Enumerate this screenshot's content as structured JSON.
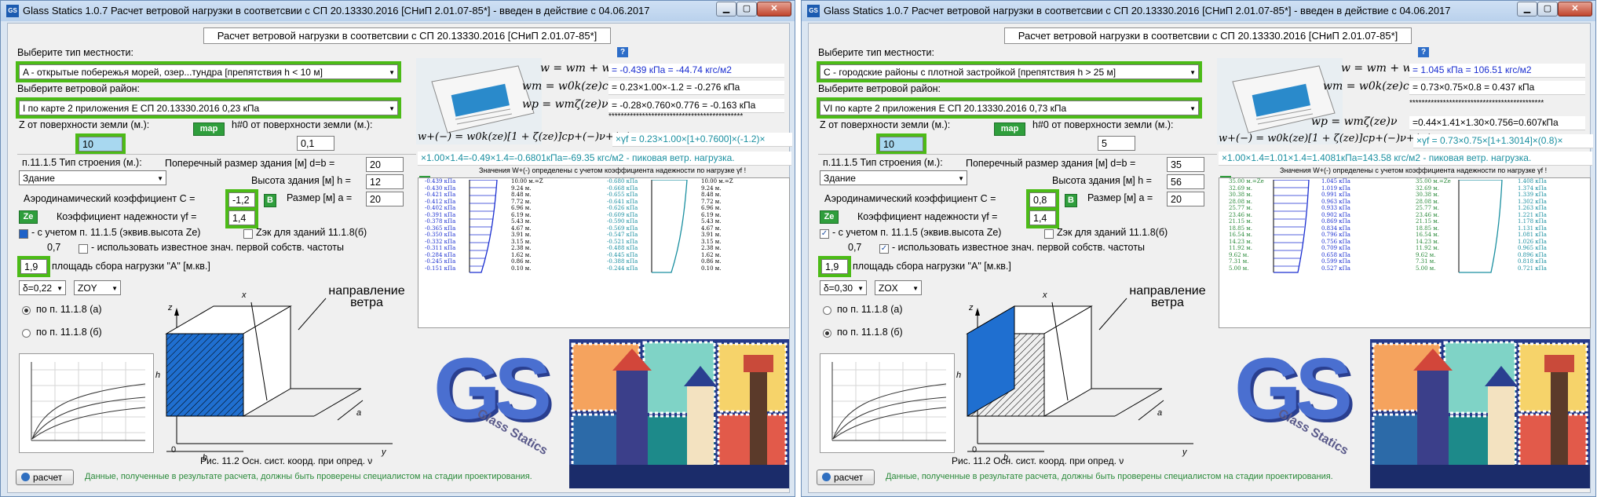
{
  "window_title": "Glass Statics 1.0.7 Расчет ветровой нагрузки в соответсвии с СП 20.13330.2016 [СНиП 2.01.07-85*] - введен в действие с 04.06.2017",
  "header": "Расчет ветровой нагрузки в соответсвии с СП 20.13330.2016 [СНиП 2.01.07-85*]",
  "labels": {
    "terrain": "Выберите тип местности:",
    "region": "Выберите ветровой район:",
    "z_label": "Z от поверхности земли (м.):",
    "h0_label": "h#0 от поверхности земли (м.):",
    "map_btn": "map",
    "type_label": "п.11.1.5 Тип строения (м.):",
    "d_label": "Поперечный размер здания [м] d=b =",
    "h_label": "Высота здания [м] h =",
    "a_label": "Размер [м] a =",
    "aero_label": "Аэродинамический коэффициент С =",
    "safety_label": "Коэффициент надежности γf =",
    "ze_btn": "Ze",
    "b_btn": "B",
    "chk_ze": "- с учетом п. 11.1.5 (эквив.высота Ze)",
    "chk_zek": "Zэк для зданий 11.1.8(б)",
    "chk_freq": "- использовать известное знач. первой собств. частоты",
    "area_label": "площадь сбора нагрузки \"А\" [м.кв.]",
    "radio_a": "по п. 11.1.8 (а)",
    "radio_b": "по п. 11.1.8 (б)",
    "wind_dir": "направление ветра",
    "fig_caption": "Рис. 11.2 Осн. сист. коорд. при опред. ν",
    "note_w": "Значения W+(-) определены с учетом коэффициента надежности по нагрузке γf !",
    "calc_btn": "расчет",
    "footer": "Данные, полученные в результате расчета, должны быть проверены специалистом на стадии проектирования.",
    "stars": "********************************************"
  },
  "formulas": {
    "w": "w = wm + wp",
    "wm": "wm = w0k(ze)c",
    "wp": "wp = wmζ(ze)ν",
    "wpm": "w+(−) = w0k(ze)[1 + ζ(ze)]cp+(−)ν+(−)"
  },
  "left": {
    "terrain": "A - открытые побережья морей, озер...тундра [препятствия h < 10 м]",
    "region": "I        по карте 2 приложения Е СП 20.13330.2016        0,23 кПа",
    "z": "10",
    "h0": "0,1",
    "type": "Здание",
    "d": "20",
    "h": "12",
    "a": "20",
    "c": "-1,2",
    "gf": "1,4",
    "freq": "0,7",
    "area": "1,9",
    "delta": "δ=0,22",
    "plane": "ZOY",
    "chk_ze_on": true,
    "chk_freq_on": false,
    "radio_a_on": true,
    "res_w": "= -0.439 кПа = -44.74 кгс/м2",
    "res_wm": "= 0.23×1.00×-1.2 = -0.276 кПа",
    "res_wp": "= -0.28×0.760×0.776 = -0.163 кПа",
    "res_wpm_a": "×γf = 0.23×1.00×[1+0.7600]×(-1.2)×",
    "res_wpm_b": "×1.00×1.4=-0.49×1.4=-0.6801кПа=-69.35 кгс/м2 - пиковая ветр. нагрузка.",
    "col1_vals": "-0.439 кПа\n-0.430 кПа\n-0.421 кПа\n-0.412 кПа\n-0.402 кПа\n-0.391 кПа\n-0.378 кПа\n-0.365 кПа\n-0.350 кПа\n-0.332 кПа\n-0.311 кПа\n-0.284 кПа\n-0.245 кПа\n-0.151 кПа",
    "col1_z": "10.00 м.=Z\n9.24 м.\n8.48 м.\n7.72 м.\n6.96 м.\n6.19 м.\n5.43 м.\n4.67 м.\n3.91 м.\n3.15 м.\n2.38 м.\n1.62 м.\n0.86 м.\n0.10 м.",
    "col2_vals": "-0.680 кПа\n-0.668 кПа\n-0.655 кПа\n-0.641 кПа\n-0.626 кПа\n-0.609 кПа\n-0.590 кПа\n-0.569 кПа\n-0.547 кПа\n-0.521 кПа\n-0.488 кПа\n-0.445 кПа\n-0.388 кПа\n-0.244 кПа",
    "col2_z": "10.00 м.=Z\n9.24 м.\n8.48 м.\n7.72 м.\n6.96 м.\n6.19 м.\n5.43 м.\n4.67 м.\n3.91 м.\n3.15 м.\n2.38 м.\n1.62 м.\n0.86 м.\n0.10 м."
  },
  "right": {
    "terrain": "С - городские районы с плотной застройкой    [препятствия h > 25 м]",
    "region": "VI      по карте 2 приложения Е СП 20.13330.2016        0,73 кПа",
    "z": "10",
    "h0": "5",
    "type": "Здание",
    "d": "35",
    "h": "56",
    "a": "20",
    "c": "0,8",
    "gf": "1,4",
    "freq": "0,7",
    "area": "1,9",
    "delta": "δ=0,30",
    "plane": "ZOX",
    "chk_ze_on": true,
    "chk_freq_on": true,
    "radio_a_on": false,
    "res_w": "= 1.045 кПа = 106.51 кгс/м2",
    "res_wm": "= 0.73×0.75×0.8 = 0.437 кПа",
    "res_wp": "=0.44×1.41×1.30×0.756=0.607кПа",
    "res_wpm_a": "×γf = 0.73×0.75×[1+1.3014]×(0.8)×",
    "res_wpm_b": "×1.00×1.4=1.01×1.4=1.4081кПа=143.58 кгс/м2 - пиковая ветр. нагрузка.",
    "col1_vals": "1.045 кПа\n1.019 кПа\n0.991 кПа\n0.963 кПа\n0.933 кПа\n0.902 кПа\n0.869 кПа\n0.834 кПа\n0.796 кПа\n0.756 кПа\n0.709 кПа\n0.658 кПа\n0.599 кПа\n0.527 кПа",
    "col1_z": "35.00 м.=Ze\n32.69 м.\n30.38 м.\n28.08 м.\n25.77 м.\n23.46 м.\n21.15 м.\n18.85 м.\n16.54 м.\n14.23 м.\n11.92 м.\n9.62 м.\n7.31 м.\n5.00 м.",
    "col2_vals": "1.408 кПа\n1.374 кПа\n1.339 кПа\n1.302 кПа\n1.263 кПа\n1.221 кПа\n1.178 кПа\n1.131 кПа\n1.081 кПа\n1.026 кПа\n0.965 кПа\n0.896 кПа\n0.818 кПа\n0.721 кПа",
    "col2_z": "35.00 м.=Ze\n32.69 м.\n30.38 м.\n28.08 м.\n25.77 м.\n23.46 м.\n21.15 м.\n18.85 м.\n16.54 м.\n14.23 м.\n11.92 м.\n9.62 м.\n7.31 м.\n5.00 м."
  },
  "logo_text": "GS",
  "logo_sub": "Glass Statics",
  "fig_axes": {
    "z": "z",
    "x": "x",
    "y": "y",
    "h": "h",
    "a": "a",
    "b": "b",
    "zero": "0"
  },
  "icons": {
    "app": "gs-icon",
    "help": "help-icon"
  },
  "colors": {
    "green": "#4cbb17",
    "blue_fill": "#1f6fd0",
    "result_blue": "#1a2ed0",
    "result_teal": "#1a8fa0"
  }
}
